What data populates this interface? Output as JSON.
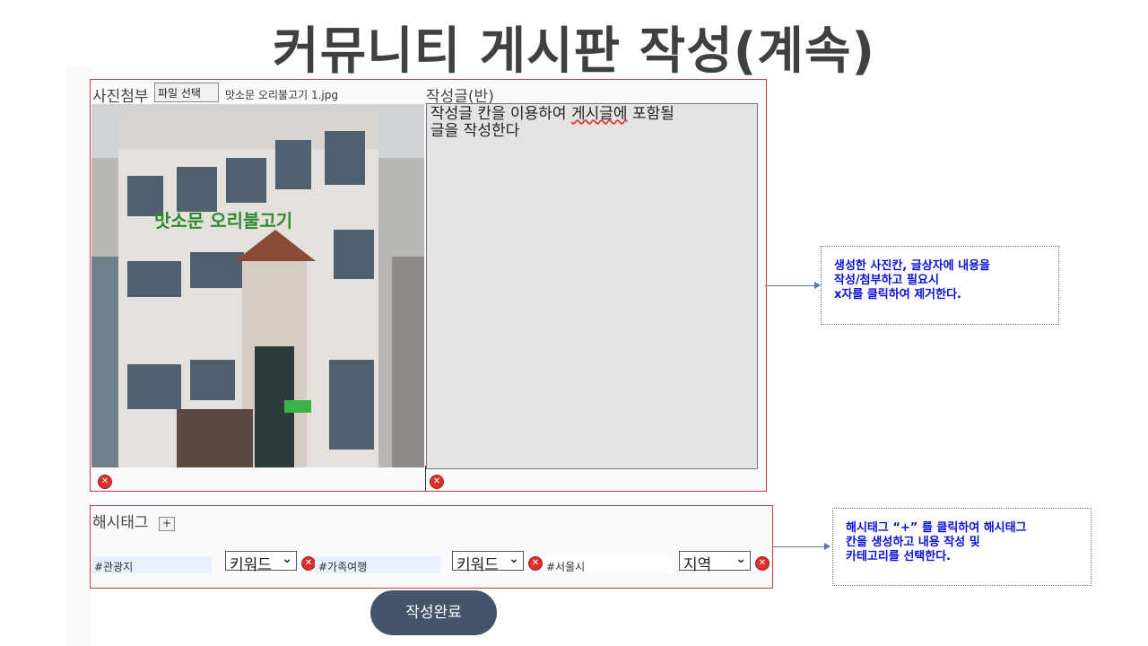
{
  "title": "커뮤니티 게시판 작성(계속)",
  "photo_panel": {
    "label": "사진첨부",
    "file_button": "파일 선택",
    "file_name": "맛소문 오리불고기 1.jpg",
    "image_sign": "맛소문 오리불고기"
  },
  "text_panel": {
    "label": "작성글(반)",
    "content_line1_pre": "작성글 칸을 이용하여 ",
    "content_line1_squiggle": "게시글에",
    "content_line1_post": " 포함될",
    "content_line2": "글을 작성한다"
  },
  "hashtags": {
    "label": "해시태그",
    "add_button": "+",
    "items": [
      {
        "tag": "#관광지",
        "category": "키워드"
      },
      {
        "tag": "#가족여행",
        "category": "키워드"
      },
      {
        "tag": "#서울시",
        "category": "지역"
      }
    ]
  },
  "submit_label": "작성완료",
  "notes": {
    "note1": [
      "생성한 사진칸, 글상자에 내용을",
      "작성/첨부하고 필요시",
      "x자를 클릭하여 제거한다."
    ],
    "note2": [
      "해시태그 “+” 를 클릭하여 해시태그",
      "칸을 생성하고 내용 작성 및",
      "카테고리를 선택한다."
    ]
  },
  "icons": {
    "remove": "close-circle-icon",
    "dropdown": "chevron-down-icon"
  },
  "colors": {
    "panel_border": "#d6373b",
    "note_text": "#0b10d8",
    "submit_bg": "#44546a",
    "remove_icon": "#d8302f"
  }
}
